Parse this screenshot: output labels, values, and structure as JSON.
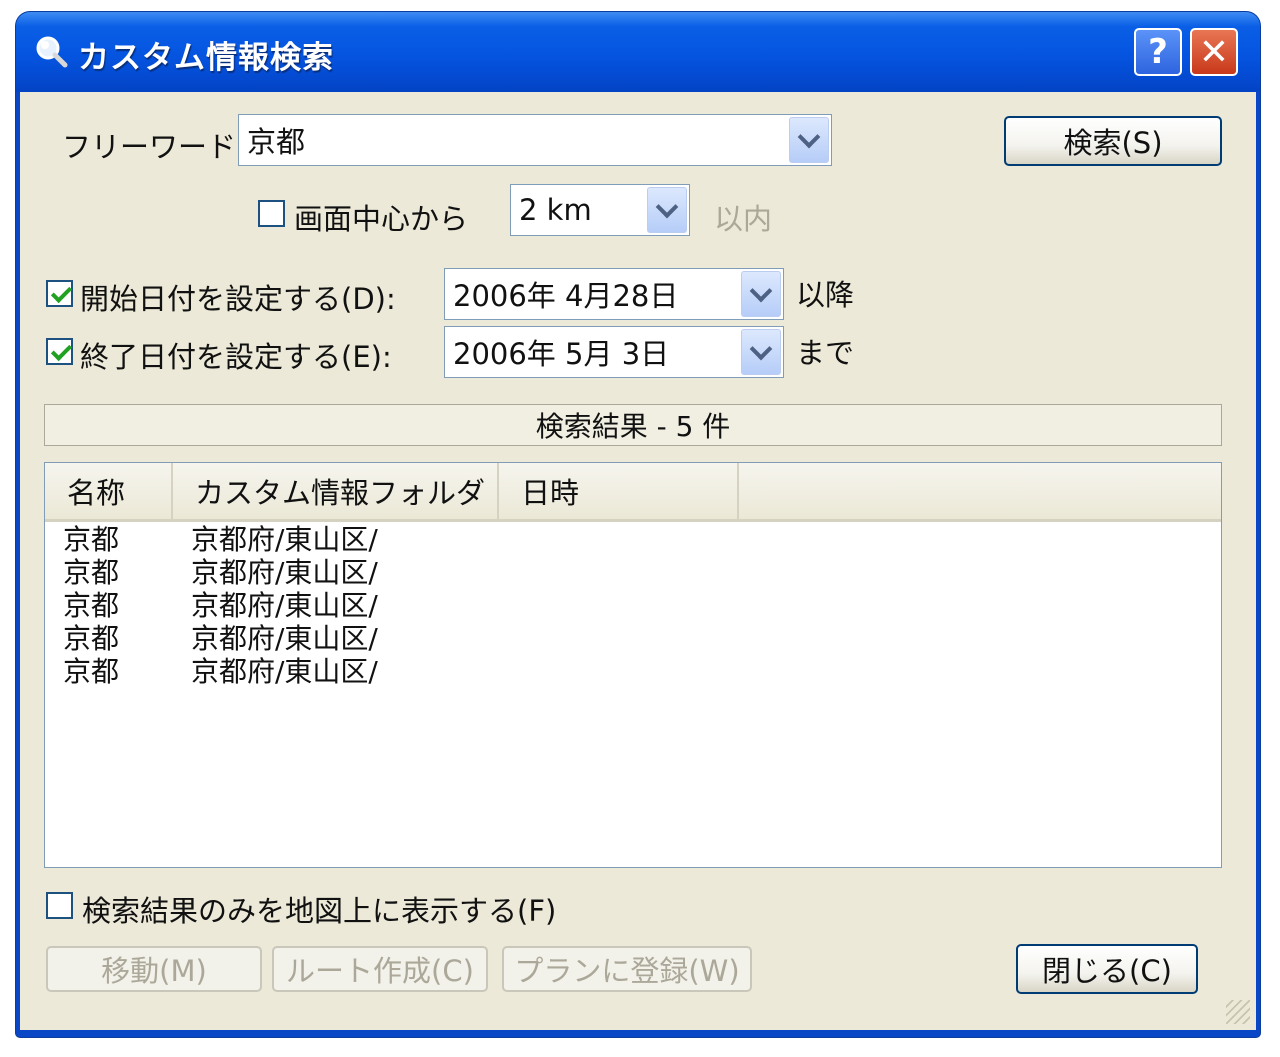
{
  "window": {
    "title": "カスタム情報検索",
    "help_label": "?",
    "close_label": "✕"
  },
  "search": {
    "freeword_label": "フリーワード:",
    "freeword_value": "京都",
    "search_button": "検索(S)",
    "center_checkbox_label": "画面中心から",
    "center_checkbox_checked": false,
    "distance_value": "2 km",
    "within_label": "以内"
  },
  "dates": {
    "start_label": "開始日付を設定する(D):",
    "start_checked": true,
    "start_value": "2006年  4月28日",
    "start_suffix": "以降",
    "end_label": "終了日付を設定する(E):",
    "end_checked": true,
    "end_value": "2006年  5月  3日",
    "end_suffix": "まで"
  },
  "results": {
    "status": "検索結果 - 5 件",
    "columns": [
      "名称",
      "カスタム情報フォルダ",
      "日時"
    ],
    "rows": [
      [
        "京都",
        "京都府/東山区/",
        ""
      ],
      [
        "京都",
        "京都府/東山区/",
        ""
      ],
      [
        "京都",
        "京都府/東山区/",
        ""
      ],
      [
        "京都",
        "京都府/東山区/",
        ""
      ],
      [
        "京都",
        "京都府/東山区/",
        ""
      ]
    ]
  },
  "options": {
    "map_only_label": "検索結果のみを地図上に表示する(F)",
    "map_only_checked": false
  },
  "buttons": {
    "move": "移動(M)",
    "route": "ルート作成(C)",
    "plan": "プランに登録(W)",
    "close": "閉じる(C)"
  },
  "colors": {
    "title_bar": "#0554e0",
    "dialog_face": "#ece9d8",
    "close_button": "#c8391a",
    "checkmark": "#21a121"
  },
  "icons": [
    "magnifier-icon",
    "help-icon",
    "close-icon",
    "chevron-down-icon",
    "checkmark-icon",
    "resize-grip-icon"
  ]
}
